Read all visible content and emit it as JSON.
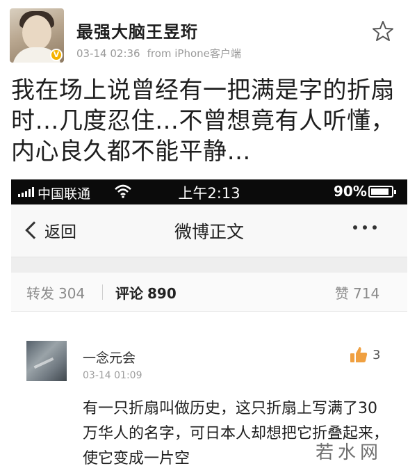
{
  "post": {
    "author": "最强大脑王昱珩",
    "time": "03-14 02:36",
    "source": "from iPhone客户端",
    "text": "我在场上说曾经有一把满是字的折扇时…几度忍住…不曾想竟有人听懂，内心良久都不能平静…"
  },
  "status_bar": {
    "carrier": "中国联通",
    "time": "上午2:13",
    "battery": "90%",
    "battery_level": 0.9
  },
  "nav": {
    "back_label": "返回",
    "title": "微博正文"
  },
  "stats": {
    "repost_label": "转发",
    "repost_count": "304",
    "comment_label": "评论",
    "comment_count": "890",
    "like_label": "赞",
    "like_count": "714"
  },
  "comment": {
    "author": "一念元会",
    "time": "03-14 01:09",
    "likes": "3",
    "text": "有一只折扇叫做历史，这只折扇上写满了30万华人的名字，可日本人却想把它折叠起来，使它变成一片空"
  },
  "watermark": "若水网",
  "colors": {
    "accent_orange": "#f08a24",
    "status_bar_bg": "#0b0b0b",
    "meta_gray": "#9a9a9a"
  },
  "icons": [
    "star-icon",
    "signal-icon",
    "wifi-icon",
    "battery-icon",
    "back-chevron-icon",
    "more-dots-icon",
    "thumbs-up-icon"
  ]
}
